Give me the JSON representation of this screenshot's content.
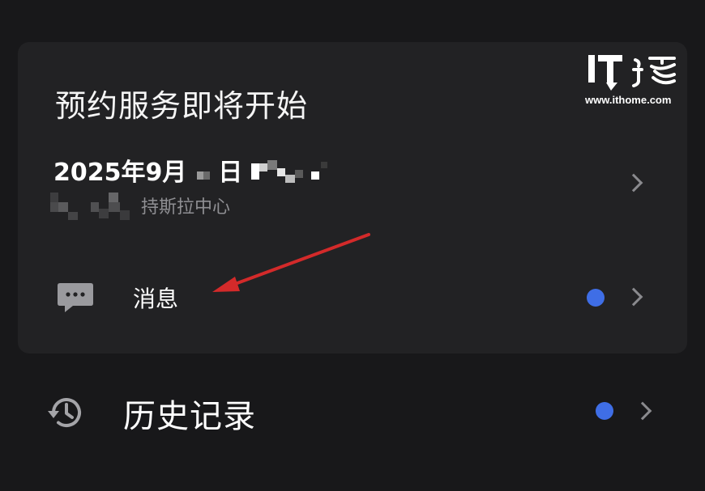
{
  "card": {
    "title": "预约服务即将开始",
    "appointment": {
      "date_text": "2025年9月",
      "day_suffix": "日",
      "location_text": "持斯拉中心"
    },
    "message": {
      "label": "消息",
      "icon": "message-icon",
      "unread": true
    }
  },
  "history": {
    "label": "历史记录",
    "icon": "history-clock-icon",
    "unread": true
  },
  "watermark": {
    "url": "www.ithome.com"
  },
  "colors": {
    "background": "#18181a",
    "card": "#222224",
    "unread_dot": "#3f6ee6",
    "annotation_arrow": "#d32a2a"
  }
}
